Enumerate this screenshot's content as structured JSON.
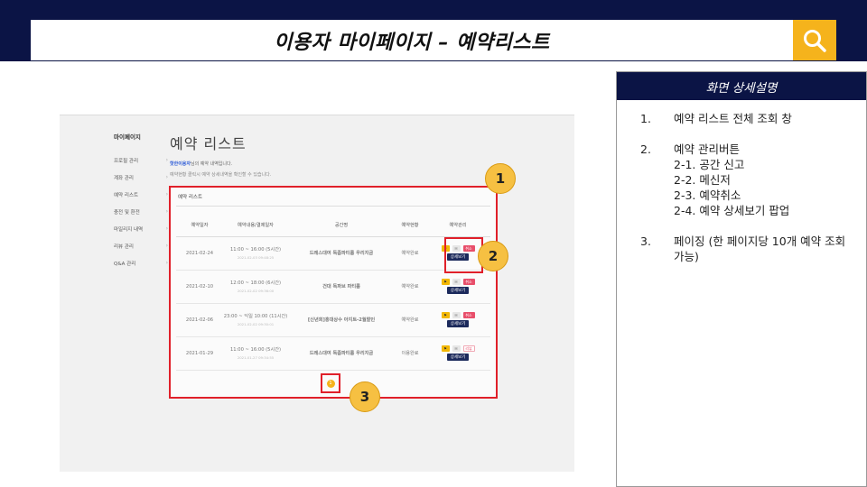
{
  "title": "이용자 마이페이지 – 예약리스트",
  "icons": {
    "search": "search-icon"
  },
  "colors": {
    "navy": "#0b1445",
    "accent": "#f5b31c",
    "highlight": "#e0202a"
  },
  "shot": {
    "sidebar": {
      "title": "마이페이지",
      "items": [
        "프로필 관리",
        "계좌 관리",
        "예약 리스트",
        "충전 및 환전",
        "마일리지 내역",
        "리뷰 관리",
        "Q&A 관리"
      ]
    },
    "page_title": "예약 리스트",
    "sub_user": "핫한이용자",
    "sub_user_suffix": "님의 예약 내역입니다.",
    "sub_hint": "예약현황 클릭시 예약 상세내역을 확인할 수 있습니다.",
    "panel_title": "예약 리스트",
    "columns": [
      "예약일자",
      "예약내용/결제일자",
      "공간명",
      "예약현황",
      "예약관리"
    ],
    "rows": [
      {
        "date": "2021-02-24",
        "time": "11:00 ~ 16:00 (5시간)",
        "paid": "2021-02-03 09:48:25",
        "space": "드레스대여 독좀파티룸 우리지금",
        "status": "예약완료",
        "cancel": "취소"
      },
      {
        "date": "2021-02-10",
        "time": "12:00 ~ 18:00 (6시간)",
        "paid": "2021-02-02 09:36:00",
        "space": "건대 독파브 파티룸",
        "status": "예약완료",
        "cancel": "취소"
      },
      {
        "date": "2021-02-06",
        "time": "23:00 ~ 익일 10:00 (11시간)",
        "paid": "2021-02-02 09:30:01",
        "space": "[신년회]홍대상수 아지트-2월할인",
        "status": "예약완료",
        "cancel": "취소"
      },
      {
        "date": "2021-01-29",
        "time": "11:00 ~ 16:00 (5시간)",
        "paid": "2021-01-27 09:34:55",
        "space": "드레스대여 독좀파티룸 우리지금",
        "status": "이용완료",
        "cancel": "리뷰"
      }
    ],
    "detail_label": "상세보기",
    "pager": [
      "1"
    ]
  },
  "badges": [
    "1",
    "2",
    "3"
  ],
  "right_panel": {
    "title": "화면 상세설명",
    "entries": [
      {
        "num": "1.",
        "lines": [
          "예약 리스트 전체 조회 창"
        ]
      },
      {
        "num": "2.",
        "lines": [
          "예약 관리버튼",
          "2-1. 공간 신고",
          "2-2. 메신저",
          "2-3. 예약취소",
          "2-4. 예약 상세보기 팝업"
        ]
      },
      {
        "num": "3.",
        "lines": [
          "페이징 (한 페이지당 10개 예약 조회 가능)"
        ]
      }
    ]
  }
}
